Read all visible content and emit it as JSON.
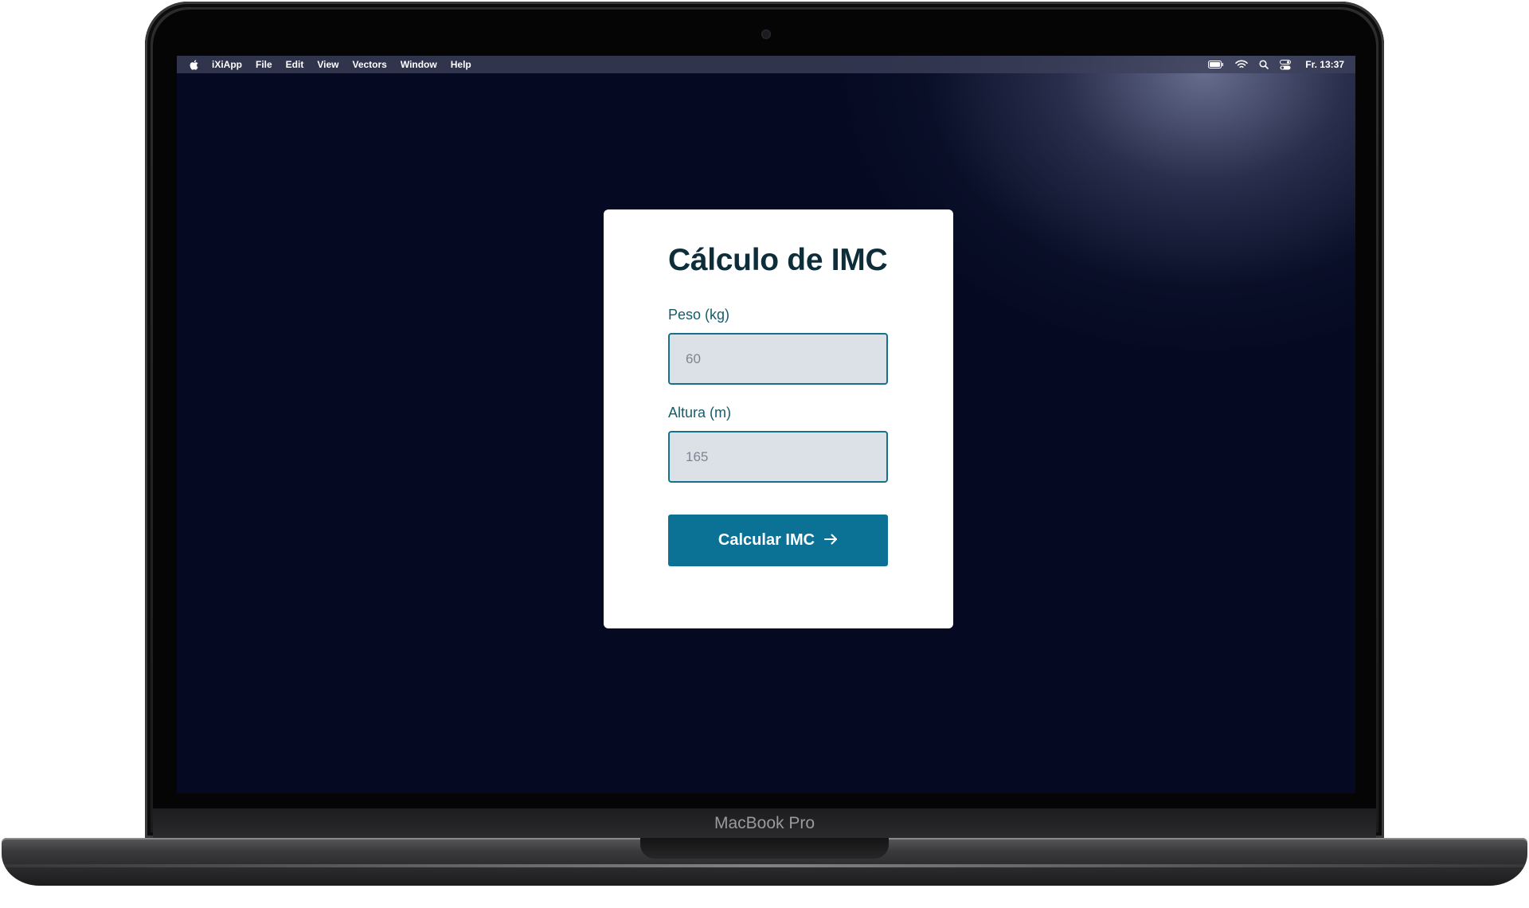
{
  "menubar": {
    "app_name": "iXiApp",
    "items": [
      "File",
      "Edit",
      "View",
      "Vectors",
      "Window",
      "Help"
    ],
    "clock": "Fr. 13:37"
  },
  "form": {
    "title": "Cálculo de IMC",
    "weight": {
      "label": "Peso (kg)",
      "placeholder": "60"
    },
    "height": {
      "label": "Altura (m)",
      "placeholder": "165"
    },
    "submit_label": "Calcular IMC"
  },
  "device": {
    "brand_label": "MacBook Pro"
  },
  "colors": {
    "desktop_background": "#050a22",
    "button_accent": "#0b7295",
    "title_text": "#0d2d3a",
    "label_text": "#155c6b",
    "input_border": "#16728a",
    "input_background": "#dce1e8"
  },
  "icons": {
    "apple": "apple-logo-icon",
    "battery": "battery-icon",
    "wifi": "wifi-icon",
    "search": "search-icon",
    "control_center": "control-center-icon",
    "button_arrow": "arrow-right-icon"
  }
}
